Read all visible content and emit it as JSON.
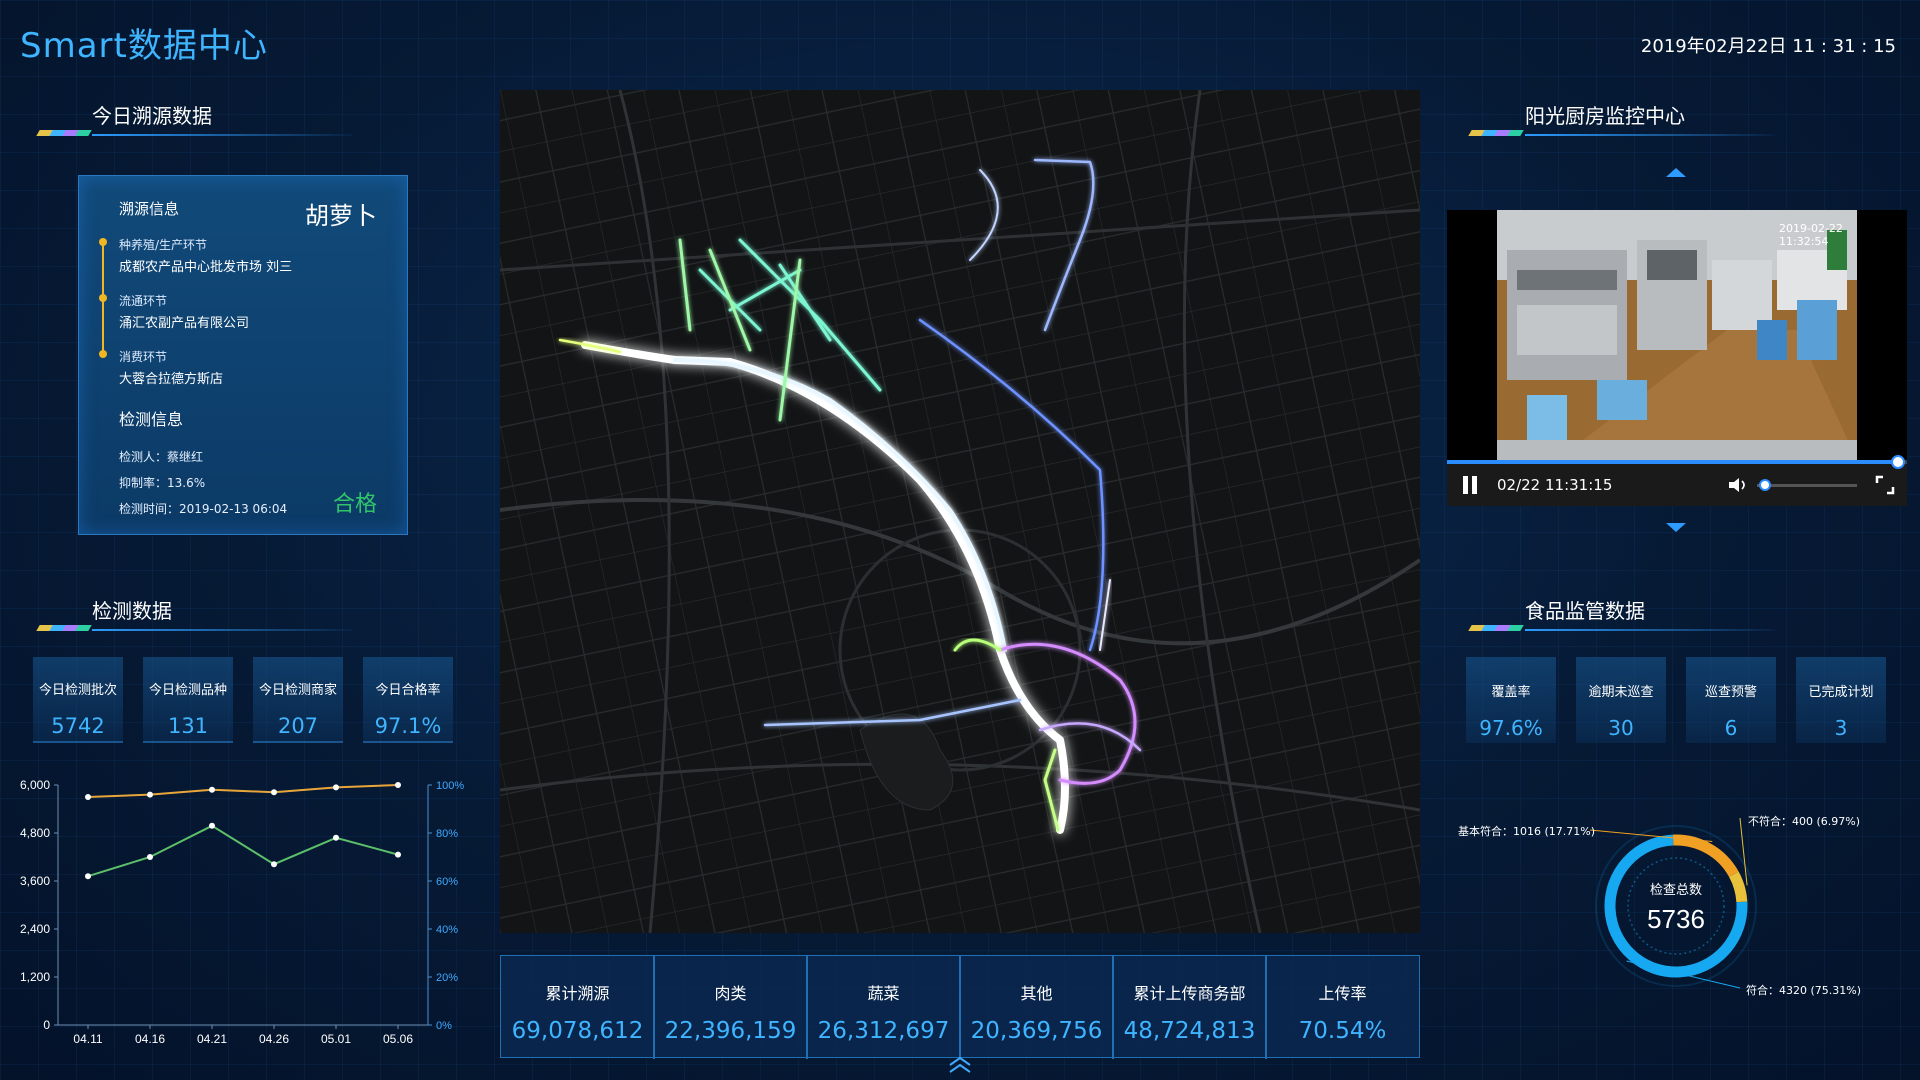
{
  "header": {
    "app_title": "Smart数据中心",
    "datetime": "2019年02月22日 11 : 31 : 15"
  },
  "trace": {
    "section_title": "今日溯源数据",
    "card_title": "溯源信息",
    "product": "胡萝卜",
    "steps": [
      {
        "label": "种养殖/生产环节",
        "value": "成都农产品中心批发市场 刘三"
      },
      {
        "label": "流通环节",
        "value": "涌汇农副产品有限公司"
      },
      {
        "label": "消费环节",
        "value": "大蓉合拉德方斯店"
      }
    ],
    "inspection_title": "检测信息",
    "inspector": "检测人：蔡继红",
    "inhibition": "抑制率：13.6%",
    "inspect_time": "检测时间：2019-02-13 06:04",
    "result": "合格"
  },
  "detection": {
    "section_title": "检测数据",
    "stats": [
      {
        "label": "今日检测批次",
        "value": "5742"
      },
      {
        "label": "今日检测品种",
        "value": "131"
      },
      {
        "label": "今日检测商家",
        "value": "207"
      },
      {
        "label": "今日合格率",
        "value": "97.1%"
      }
    ]
  },
  "chart_data": {
    "type": "line",
    "title": "",
    "xlabel": "",
    "ylabel": "",
    "categories": [
      "04.11",
      "04.16",
      "04.21",
      "04.26",
      "05.01",
      "05.06"
    ],
    "left_axis": {
      "ticks": [
        "0",
        "1,200",
        "2,400",
        "3,600",
        "4,800",
        "6,000"
      ],
      "range": [
        0,
        6000
      ]
    },
    "right_axis": {
      "ticks": [
        "0%",
        "20%",
        "40%",
        "60%",
        "80%",
        "100%"
      ],
      "range": [
        0,
        100
      ]
    },
    "series": [
      {
        "axis": "right",
        "color": "#e8a63a",
        "values": [
          95,
          96,
          98,
          97,
          99,
          100
        ]
      },
      {
        "axis": "right",
        "color": "#5cc06a",
        "values": [
          62,
          70,
          83,
          67,
          78,
          71
        ]
      }
    ],
    "grid": false
  },
  "totals": [
    {
      "label": "累计溯源",
      "value": "69,078,612"
    },
    {
      "label": "肉类",
      "value": "22,396,159"
    },
    {
      "label": "蔬菜",
      "value": "26,312,697"
    },
    {
      "label": "其他",
      "value": "20,369,756"
    },
    {
      "label": "累计上传商务部",
      "value": "48,724,813"
    },
    {
      "label": "上传率",
      "value": "70.54%"
    }
  ],
  "kitchen": {
    "section_title": "阳光厨房监控中心",
    "video_timestamp": "2019-02-22 11:32:54",
    "player_time": "02/22 11:31:15",
    "progress": 0.98,
    "volume": 0.02
  },
  "food": {
    "section_title": "食品监管数据",
    "stats": [
      {
        "label": "覆盖率",
        "value": "97.6%"
      },
      {
        "label": "逾期未巡查",
        "value": "30"
      },
      {
        "label": "巡查预警",
        "value": "6"
      },
      {
        "label": "已完成计划",
        "value": "3"
      }
    ],
    "donut": {
      "center_label": "检查总数",
      "total": "5736",
      "basic": "基本符合：1016  (17.71%)",
      "fail": "不符合：400  (6.97%)",
      "pass": "符合：4320  (75.31%)",
      "shares": {
        "basic": 17.71,
        "fail": 6.97,
        "pass": 75.31
      },
      "colors": {
        "basic": "#f0a023",
        "fail": "#e8c23a",
        "pass": "#16a8f0"
      }
    }
  }
}
